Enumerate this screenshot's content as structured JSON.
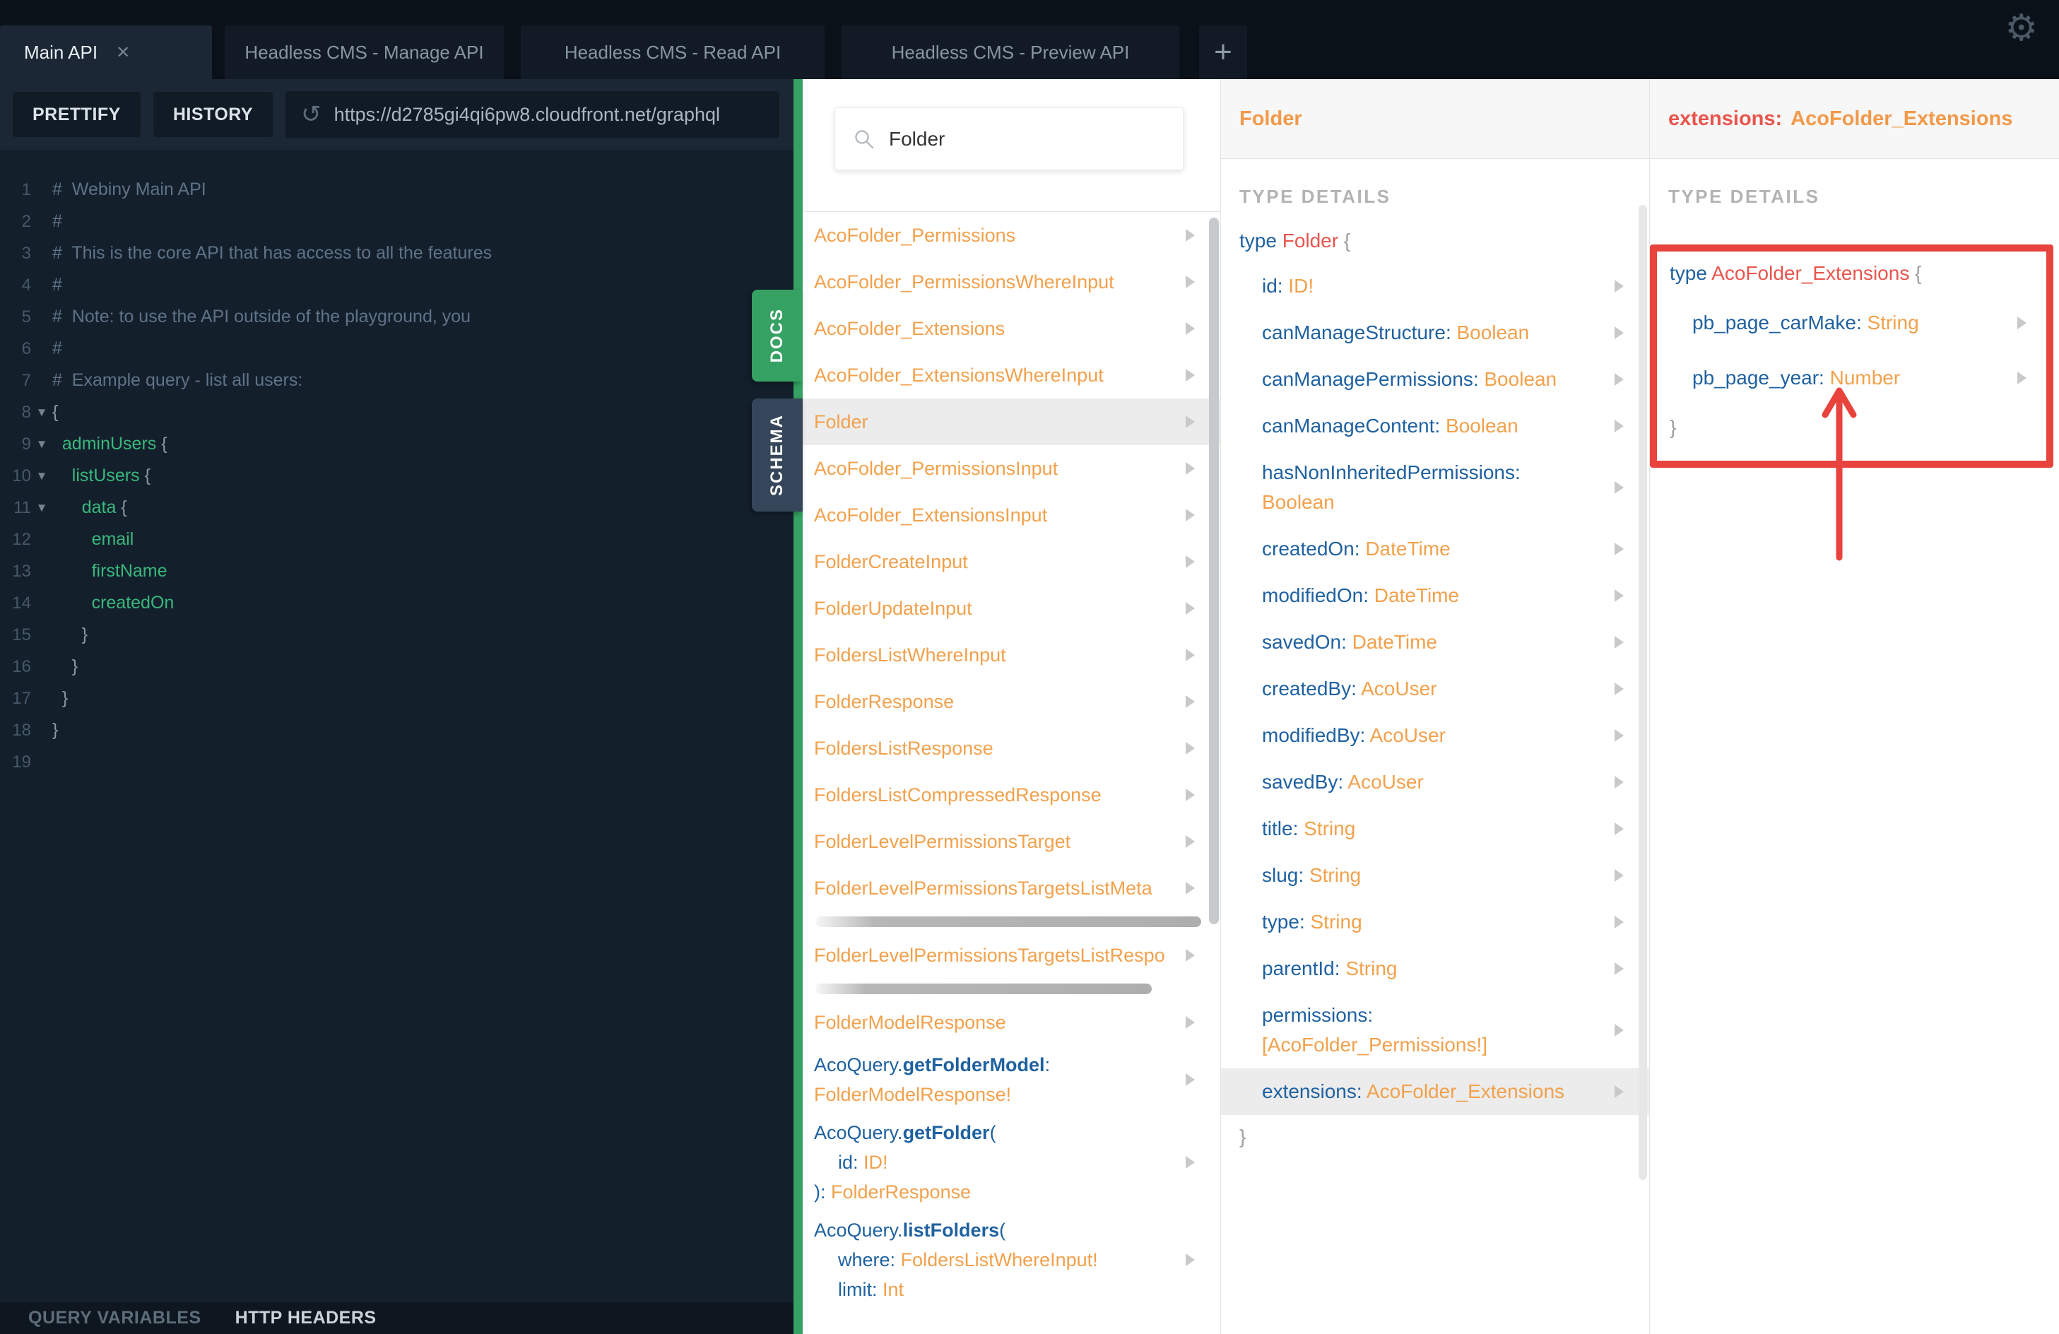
{
  "tabs": {
    "items": [
      {
        "label": "Main API",
        "active": true,
        "closable": true
      },
      {
        "label": "Headless CMS - Manage API",
        "active": false
      },
      {
        "label": "Headless CMS - Read API",
        "active": false
      },
      {
        "label": "Headless CMS - Preview API",
        "active": false
      }
    ]
  },
  "icons": {
    "gear": "⚙",
    "close": "✕",
    "plus": "+",
    "reload": "↺"
  },
  "toolbar": {
    "prettify": "PRETTIFY",
    "history": "HISTORY",
    "url": "https://d2785gi4qi6pw8.cloudfront.net/graphql"
  },
  "editor": {
    "lines": [
      {
        "n": "1",
        "fold": false,
        "parts": [
          {
            "t": "#  Webiny Main API",
            "c": "cm"
          }
        ]
      },
      {
        "n": "2",
        "fold": false,
        "parts": [
          {
            "t": "#",
            "c": "cm"
          }
        ]
      },
      {
        "n": "3",
        "fold": false,
        "parts": [
          {
            "t": "#  This is the core API that has access to all the features",
            "c": "cm"
          }
        ]
      },
      {
        "n": "4",
        "fold": false,
        "parts": [
          {
            "t": "#",
            "c": "cm"
          }
        ]
      },
      {
        "n": "5",
        "fold": false,
        "parts": [
          {
            "t": "#  Note: to use the API outside of the playground, you",
            "c": "cm"
          }
        ]
      },
      {
        "n": "6",
        "fold": false,
        "parts": [
          {
            "t": "#",
            "c": "cm"
          }
        ]
      },
      {
        "n": "7",
        "fold": false,
        "parts": [
          {
            "t": "#  Example query - list all users:",
            "c": "cm"
          }
        ]
      },
      {
        "n": "8",
        "fold": true,
        "parts": [
          {
            "t": "{",
            "c": "br"
          }
        ]
      },
      {
        "n": "9",
        "fold": true,
        "parts": [
          {
            "t": "  ",
            "c": "br"
          },
          {
            "t": "adminUsers",
            "c": "gr"
          },
          {
            "t": " {",
            "c": "br"
          }
        ]
      },
      {
        "n": "10",
        "fold": true,
        "parts": [
          {
            "t": "    ",
            "c": "br"
          },
          {
            "t": "listUsers",
            "c": "gr"
          },
          {
            "t": " {",
            "c": "br"
          }
        ]
      },
      {
        "n": "11",
        "fold": true,
        "parts": [
          {
            "t": "      ",
            "c": "br"
          },
          {
            "t": "data",
            "c": "gr"
          },
          {
            "t": " {",
            "c": "br"
          }
        ]
      },
      {
        "n": "12",
        "fold": false,
        "parts": [
          {
            "t": "        ",
            "c": "br"
          },
          {
            "t": "email",
            "c": "gr"
          }
        ]
      },
      {
        "n": "13",
        "fold": false,
        "parts": [
          {
            "t": "        ",
            "c": "br"
          },
          {
            "t": "firstName",
            "c": "gr"
          }
        ]
      },
      {
        "n": "14",
        "fold": false,
        "parts": [
          {
            "t": "        ",
            "c": "br"
          },
          {
            "t": "createdOn",
            "c": "gr"
          }
        ]
      },
      {
        "n": "15",
        "fold": false,
        "parts": [
          {
            "t": "      }",
            "c": "br"
          }
        ]
      },
      {
        "n": "16",
        "fold": false,
        "parts": [
          {
            "t": "    }",
            "c": "br"
          }
        ]
      },
      {
        "n": "17",
        "fold": false,
        "parts": [
          {
            "t": "  }",
            "c": "br"
          }
        ]
      },
      {
        "n": "18",
        "fold": false,
        "parts": [
          {
            "t": "}",
            "c": "br"
          }
        ]
      },
      {
        "n": "19",
        "fold": false,
        "parts": []
      }
    ]
  },
  "footer": {
    "query_variables": "QUERY VARIABLES",
    "http_headers": "HTTP HEADERS"
  },
  "side_tabs": {
    "docs": "DOCS",
    "schema": "SCHEMA"
  },
  "search": {
    "value": "Folder"
  },
  "explorer": {
    "items": [
      {
        "highlight": false,
        "lines": [
          {
            "ind": 0,
            "parts": [
              {
                "t": "AcoFolder_Permissions",
                "c": "o"
              }
            ]
          }
        ]
      },
      {
        "highlight": false,
        "lines": [
          {
            "ind": 0,
            "parts": [
              {
                "t": "AcoFolder_PermissionsWhereInput",
                "c": "o"
              }
            ]
          }
        ]
      },
      {
        "highlight": false,
        "lines": [
          {
            "ind": 0,
            "parts": [
              {
                "t": "AcoFolder_Extensions",
                "c": "o"
              }
            ]
          }
        ]
      },
      {
        "highlight": false,
        "lines": [
          {
            "ind": 0,
            "parts": [
              {
                "t": "AcoFolder_ExtensionsWhereInput",
                "c": "o"
              }
            ]
          }
        ]
      },
      {
        "highlight": true,
        "lines": [
          {
            "ind": 0,
            "parts": [
              {
                "t": "Folder",
                "c": "o"
              }
            ]
          }
        ]
      },
      {
        "highlight": false,
        "lines": [
          {
            "ind": 0,
            "parts": [
              {
                "t": "AcoFolder_PermissionsInput",
                "c": "o"
              }
            ]
          }
        ]
      },
      {
        "highlight": false,
        "lines": [
          {
            "ind": 0,
            "parts": [
              {
                "t": "AcoFolder_ExtensionsInput",
                "c": "o"
              }
            ]
          }
        ]
      },
      {
        "highlight": false,
        "lines": [
          {
            "ind": 0,
            "parts": [
              {
                "t": "FolderCreateInput",
                "c": "o"
              }
            ]
          }
        ]
      },
      {
        "highlight": false,
        "lines": [
          {
            "ind": 0,
            "parts": [
              {
                "t": "FolderUpdateInput",
                "c": "o"
              }
            ]
          }
        ]
      },
      {
        "highlight": false,
        "lines": [
          {
            "ind": 0,
            "parts": [
              {
                "t": "FoldersListWhereInput",
                "c": "o"
              }
            ]
          }
        ]
      },
      {
        "highlight": false,
        "lines": [
          {
            "ind": 0,
            "parts": [
              {
                "t": "FolderResponse",
                "c": "o"
              }
            ]
          }
        ]
      },
      {
        "highlight": false,
        "lines": [
          {
            "ind": 0,
            "parts": [
              {
                "t": "FoldersListResponse",
                "c": "o"
              }
            ]
          }
        ]
      },
      {
        "highlight": false,
        "lines": [
          {
            "ind": 0,
            "parts": [
              {
                "t": "FoldersListCompressedResponse",
                "c": "o"
              }
            ]
          }
        ]
      },
      {
        "highlight": false,
        "lines": [
          {
            "ind": 0,
            "parts": [
              {
                "t": "FolderLevelPermissionsTarget",
                "c": "o"
              }
            ]
          }
        ]
      },
      {
        "highlight": false,
        "hbar": 546,
        "lines": [
          {
            "ind": 0,
            "parts": [
              {
                "t": "FolderLevelPermissionsTargetsListMeta",
                "c": "o"
              }
            ]
          }
        ]
      },
      {
        "highlight": false,
        "hbar": 476,
        "lines": [
          {
            "ind": 0,
            "parts": [
              {
                "t": "FolderLevelPermissionsTargetsListRespo",
                "c": "o"
              }
            ]
          }
        ]
      },
      {
        "highlight": false,
        "lines": [
          {
            "ind": 0,
            "parts": [
              {
                "t": "FolderModelResponse",
                "c": "o"
              }
            ]
          }
        ]
      },
      {
        "highlight": false,
        "lines": [
          {
            "ind": 0,
            "parts": [
              {
                "t": "AcoQuery.",
                "c": "b"
              },
              {
                "t": "getFolderModel",
                "c": "bb"
              },
              {
                "t": ":",
                "c": "b"
              }
            ]
          },
          {
            "ind": 0,
            "parts": [
              {
                "t": "FolderModelResponse!",
                "c": "o"
              }
            ]
          }
        ]
      },
      {
        "highlight": false,
        "lines": [
          {
            "ind": 0,
            "parts": [
              {
                "t": "AcoQuery.",
                "c": "b"
              },
              {
                "t": "getFolder",
                "c": "bb"
              },
              {
                "t": "(",
                "c": "b"
              }
            ]
          },
          {
            "ind": 1,
            "parts": [
              {
                "t": "id",
                "c": "b"
              },
              {
                "t": ": ",
                "c": "b"
              },
              {
                "t": "ID!",
                "c": "o"
              }
            ]
          },
          {
            "ind": 0,
            "parts": [
              {
                "t": "): ",
                "c": "b"
              },
              {
                "t": "FolderResponse",
                "c": "o"
              }
            ]
          }
        ]
      },
      {
        "highlight": false,
        "lines": [
          {
            "ind": 0,
            "parts": [
              {
                "t": "AcoQuery.",
                "c": "b"
              },
              {
                "t": "listFolders",
                "c": "bb"
              },
              {
                "t": "(",
                "c": "b"
              }
            ]
          },
          {
            "ind": 1,
            "parts": [
              {
                "t": "where",
                "c": "b"
              },
              {
                "t": ": ",
                "c": "b"
              },
              {
                "t": "FoldersListWhereInput!",
                "c": "o"
              }
            ]
          },
          {
            "ind": 1,
            "parts": [
              {
                "t": "limit",
                "c": "b"
              },
              {
                "t": ": ",
                "c": "b"
              },
              {
                "t": "Int",
                "c": "o"
              }
            ]
          }
        ]
      }
    ]
  },
  "folder_panel": {
    "title": "Folder",
    "section": "TYPE DETAILS",
    "keyword": "type",
    "type_name": "Folder",
    "open_brace": "{",
    "close_brace": "}",
    "fields": [
      {
        "name": "id",
        "type": "ID!"
      },
      {
        "name": "canManageStructure",
        "type": "Boolean"
      },
      {
        "name": "canManagePermissions",
        "type": "Boolean"
      },
      {
        "name": "canManageContent",
        "type": "Boolean"
      },
      {
        "name": "hasNonInheritedPermissions",
        "type": "Boolean",
        "wrap": true
      },
      {
        "name": "createdOn",
        "type": "DateTime"
      },
      {
        "name": "modifiedOn",
        "type": "DateTime"
      },
      {
        "name": "savedOn",
        "type": "DateTime"
      },
      {
        "name": "createdBy",
        "type": "AcoUser"
      },
      {
        "name": "modifiedBy",
        "type": "AcoUser"
      },
      {
        "name": "savedBy",
        "type": "AcoUser"
      },
      {
        "name": "title",
        "type": "String"
      },
      {
        "name": "slug",
        "type": "String"
      },
      {
        "name": "type",
        "type": "String"
      },
      {
        "name": "parentId",
        "type": "String"
      },
      {
        "name": "permissions",
        "type": "[AcoFolder_Permissions!]",
        "wrap": true
      },
      {
        "name": "extensions",
        "type": "AcoFolder_Extensions",
        "highlight": true
      }
    ]
  },
  "extensions_panel": {
    "title_field": "extensions:",
    "title_type": "AcoFolder_Extensions",
    "section": "TYPE DETAILS",
    "keyword": "type",
    "type_name": "AcoFolder_Extensions",
    "open_brace": "{",
    "close_brace": "}",
    "fields": [
      {
        "name": "pb_page_carMake",
        "type": "String"
      },
      {
        "name": "pb_page_year",
        "type": "Number"
      }
    ]
  },
  "colors": {
    "accent_green": "#35a263",
    "type_orange": "#f2a14c",
    "field_blue": "#1f61a0",
    "typename_red": "#e8554d",
    "annotation_red": "#e8433c"
  }
}
